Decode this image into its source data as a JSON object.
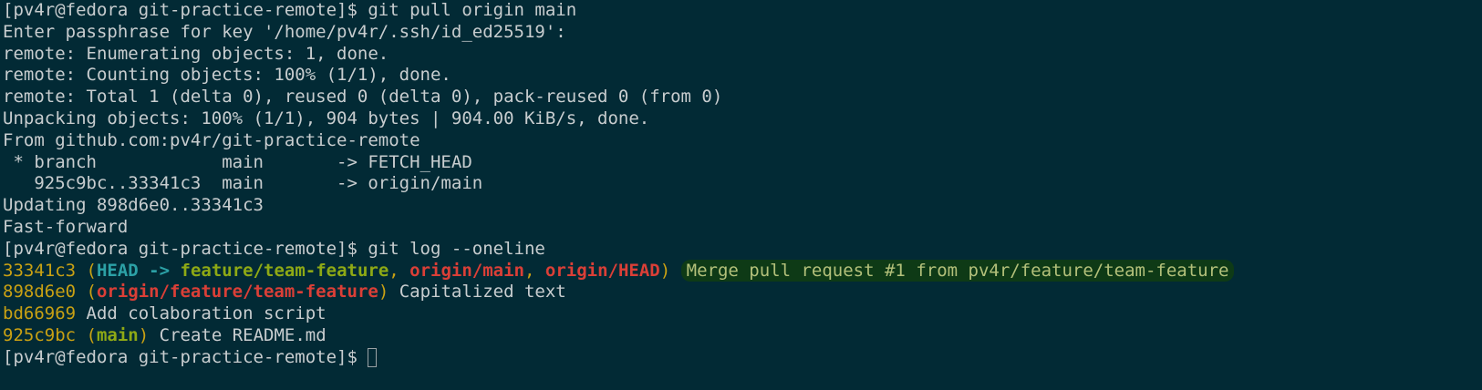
{
  "terminal": {
    "lines": [
      "[pv4r@fedora git-practice-remote]$ git pull origin main",
      "Enter passphrase for key '/home/pv4r/.ssh/id_ed25519':",
      "remote: Enumerating objects: 1, done.",
      "remote: Counting objects: 100% (1/1), done.",
      "remote: Total 1 (delta 0), reused 0 (delta 0), pack-reused 0 (from 0)",
      "Unpacking objects: 100% (1/1), 904 bytes | 904.00 KiB/s, done.",
      "From github.com:pv4r/git-practice-remote",
      " * branch            main       -> FETCH_HEAD",
      "   925c9bc..33341c3  main       -> origin/main",
      "Updating 898d6e0..33341c3",
      "Fast-forward",
      "[pv4r@fedora git-practice-remote]$ git log --oneline"
    ],
    "log": [
      {
        "hash": "33341c3",
        "open": " (",
        "head": "HEAD",
        "arrow": " -> ",
        "branch1": "feature/team-feature",
        "sep1": ", ",
        "remote1": "origin/main",
        "sep2": ", ",
        "remote2": "origin/HEAD",
        "close": ")",
        "message": "Merge pull request #1 from pv4r/feature/team-feature"
      },
      {
        "hash": "898d6e0",
        "open": " (",
        "remote1": "origin/feature/team-feature",
        "close": ")",
        "message": " Capitalized text"
      },
      {
        "hash": "bd66969",
        "message": " Add colaboration script"
      },
      {
        "hash": "925c9bc",
        "open": " (",
        "branch1": "main",
        "close": ")",
        "message": " Create README.md"
      }
    ],
    "prompt": "[pv4r@fedora git-practice-remote]$ ",
    "colors": {
      "background": "#022a35",
      "foreground": "#c8cdcf",
      "hash": "#c9a113",
      "head": "#2ca1a6",
      "local_branch": "#8ea915",
      "remote_branch": "#db3f37",
      "highlight": "#0e3a16"
    }
  }
}
